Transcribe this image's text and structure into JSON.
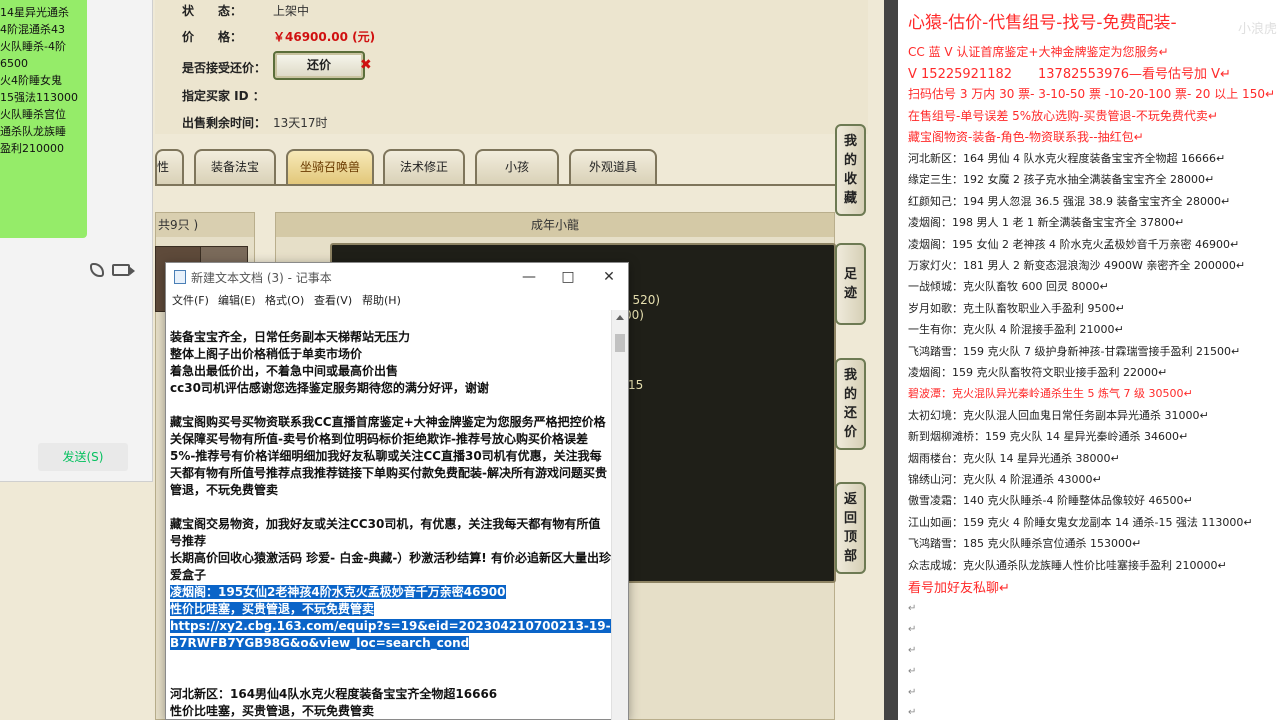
{
  "game": {
    "status_label": "状　　态：",
    "status_value": "上架中",
    "price_label": "价　　格：",
    "price_value": "￥46900.00 (元)",
    "bargain_label": "是否接受还价：",
    "bargain_button": "还价",
    "bargain_x": "✖",
    "buyer_label": "指定买家 ID ：",
    "remaining_label": "出售剩余时间：",
    "remaining_value": "13天17时",
    "tabs": [
      {
        "label": "性"
      },
      {
        "label": "装备法宝"
      },
      {
        "label": "坐骑召唤兽",
        "active": true
      },
      {
        "label": "法术修正"
      },
      {
        "label": "小孩"
      },
      {
        "label": "外观道具"
      }
    ],
    "left_panel_header": "共9只 )",
    "pet_panel_header": "成年小龍",
    "pet_stats": [
      "( 520)",
      "00)",
      "/15"
    ],
    "side_buttons": [
      "我的收藏",
      "足迹",
      "我的还价",
      "返回顶部"
    ]
  },
  "chat": {
    "lines": [
      "14星异光通杀",
      "",
      "4阶混通杀43",
      "",
      "火队睡杀-4阶",
      "6500",
      "火4阶睡女鬼",
      "15强法113000",
      "火队睡杀宫位",
      "",
      "通杀队龙族睡",
      "盈利210000"
    ],
    "send_label": "发送(S)"
  },
  "notepad": {
    "title": "新建文本文档 (3) - 记事本",
    "menus": [
      "文件(F)",
      "编辑(E)",
      "格式(O)",
      "查看(V)",
      "帮助(H)"
    ],
    "paragraphs": [
      {
        "text": "装备宝宝齐全，日常任务副本天梯帮站无压力"
      },
      {
        "text": "整体上阁子出价格稍低于单卖市场价"
      },
      {
        "text": "着急出最低价出，不着急中间或最高价出售"
      },
      {
        "text": "cc30司机评估感谢您选择鉴定服务期待您的满分好评，谢谢"
      },
      {
        "text": ""
      },
      {
        "text": "藏宝阁购买号买物资联系我CC直播首席鉴定+大神金牌鉴定为您服务严格把控价格关保障买号物有所值-卖号价格到位明码标价拒绝欺诈-推荐号放心购买价格误差5%-推荐号有价格详细明细加我好友私聊或关注CC直播30司机有优惠，关注我每天都有物有所值号推荐点我推荐链接下单购买付款免费配装-解决所有游戏问题买贵管退，不玩免费管卖"
      },
      {
        "text": ""
      },
      {
        "text": "藏宝阁交易物资，加我好友或关注CC30司机，有优惠，关注我每天都有物有所值号推荐"
      },
      {
        "text": "长期高价回收心猿激活码 珍爱- 白金-典藏-）秒激活秒结算! 有价必追新区大量出珍爱盒子"
      },
      {
        "text": "凌烟阁：195女仙2老神孩4阶水克火孟极妙音千万亲密46900",
        "sel": true
      },
      {
        "text": "性价比哇塞，买贵管退，不玩免费管卖",
        "sel": true
      },
      {
        "text": "https://xy2.cbg.163.com/equip?s=19&eid=202304210700213-19-B7RWFB7YGB98G&o&view_loc=search_cond",
        "sel": true
      },
      {
        "text": ""
      },
      {
        "text": ""
      },
      {
        "text": "河北新区：164男仙4队水克火程度装备宝宝齐全物超16666"
      },
      {
        "text": "性价比哇塞，买贵管退，不玩免费管卖"
      }
    ]
  },
  "doc": {
    "heading": "心猿-估价-代售组号-找号-免费配装-",
    "red_lines": [
      "CC 蓝 V 认证首席鉴定+大神金牌鉴定为您服务↵",
      "V 15225921182　　13782553976—看号估号加 V↵",
      "扫码估号 3 万内 30 票- 3-10-50 票 -10-20-100 票- 20 以上 150↵",
      "在售组号-单号误差 5%放心选购-买贵管退-不玩免费代卖↵",
      "藏宝阁物资-装备-角色-物资联系我--抽红包↵"
    ],
    "listings": [
      {
        "text": "河北新区：164 男仙 4 队水克火程度装备宝宝齐全物超 16666↵"
      },
      {
        "text": "缘定三生：192 女魔 2 孩子克水抽全满装备宝宝齐全 28000↵"
      },
      {
        "text": "红颜知己：194 男人忽混 36.5 强混 38.9 装备宝宝齐全 28000↵"
      },
      {
        "text": "凌烟阁：198 男人 1 老 1 新全满装备宝宝齐全 37800↵"
      },
      {
        "text": "凌烟阁：195 女仙 2 老神孩 4 阶水克火孟极妙音千万亲密 46900↵"
      },
      {
        "text": "万家灯火：181 男人 2 新变态混浪淘沙 4900W 亲密齐全 200000↵"
      },
      {
        "text": "一战倾城：克火队畜牧 600 回灵 8000↵"
      },
      {
        "text": "岁月如歌：克土队畜牧职业入手盈利 9500↵"
      },
      {
        "text": "一生有你：克火队 4 阶混接手盈利 21000↵"
      },
      {
        "text": "飞鸿踏雪：159 克火队 7 级护身新神孩-甘霖瑞雪接手盈利 21500↵"
      },
      {
        "text": "凌烟阁：159 克火队畜牧符文职业接手盈利 22000↵"
      },
      {
        "text": "碧波潭：克火混队异光秦岭通杀生生 5 炼气 7 级 30500↵",
        "hl": true
      },
      {
        "text": "太初幻境：克火队混人回血鬼日常任务副本异光通杀 31000↵"
      },
      {
        "text": "新到烟柳滩桥：159 克火队 14 星异光秦岭通杀 34600↵"
      },
      {
        "text": "烟雨楼台：克火队 14 星异光通杀 38000↵"
      },
      {
        "text": "锦绣山河：克火队 4 阶混通杀 43000↵"
      },
      {
        "text": "傲雪凌霜：140 克火队睡杀-4 阶睡整体品像较好 46500↵"
      },
      {
        "text": "江山如画：159 克火 4 阶睡女鬼女龙副本 14 通杀-15 强法 113000↵"
      },
      {
        "text": "飞鸿踏雪：185 克火队睡杀宫位通杀 153000↵"
      },
      {
        "text": "众志成城：克火队通杀队龙族睡人性价比哇塞接手盈利 210000↵"
      }
    ],
    "footer": "看号加好友私聊↵",
    "marks": [
      "↵",
      "↵",
      "↵",
      "↵",
      "↵",
      "↵"
    ],
    "watermark": "小浪虎"
  }
}
